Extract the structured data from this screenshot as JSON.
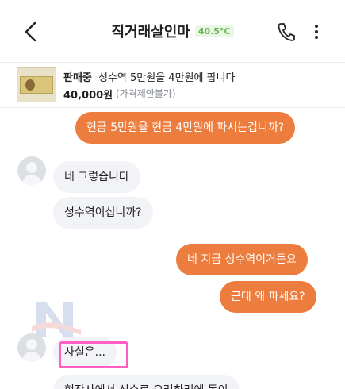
{
  "header": {
    "title": "직거래살인마",
    "temperature": "40.5°C",
    "icons": {
      "back": "back-arrow-icon",
      "phone": "phone-icon",
      "more": "more-vertical-icon"
    }
  },
  "product": {
    "status": "판매중",
    "title": "성수역 5만원을 4만원에 팝니다",
    "price": "40,000원",
    "price_note": "(가격제안불가)"
  },
  "messages": [
    {
      "side": "sent",
      "text": "현금 5만원을 현금 4만원에 파시는겁니까?"
    },
    {
      "side": "recv",
      "text": "네 그렇습니다"
    },
    {
      "side": "recv",
      "text": "성수역이십니까?"
    },
    {
      "side": "sent",
      "text": "네 지금 성수역이거든요"
    },
    {
      "side": "sent",
      "text": "근데 왜 파세요?"
    },
    {
      "side": "recv",
      "text": "사실은..."
    },
    {
      "side": "recv",
      "text": "현장사에서 성수로 오려하려에 돈이"
    }
  ],
  "colors": {
    "sent_bubble": "#ec7d3f",
    "recv_bubble": "#f2f3f6",
    "temperature": "#67b94f",
    "highlight": "#ff5fc4"
  }
}
